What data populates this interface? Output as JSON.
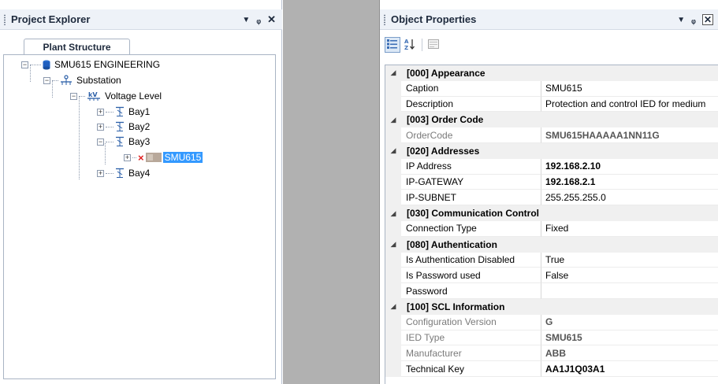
{
  "project_explorer": {
    "title": "Project Explorer",
    "tab": "Plant Structure",
    "tree": {
      "root": "SMU615 ENGINEERING",
      "substation": "Substation",
      "voltage_level": "Voltage Level",
      "bays": [
        "Bay1",
        "Bay2",
        "Bay3",
        "Bay4"
      ],
      "ied": "SMU615"
    }
  },
  "object_properties": {
    "title": "Object Properties",
    "categories": [
      {
        "label": "[000] Appearance",
        "props": [
          {
            "name": "Caption",
            "value": "SMU615"
          },
          {
            "name": "Description",
            "value": "Protection and control IED for medium"
          }
        ]
      },
      {
        "label": "[003] Order Code",
        "props": [
          {
            "name": "OrderCode",
            "value": "SMU615HAAAAA1NN11G"
          }
        ]
      },
      {
        "label": "[020] Addresses",
        "props": [
          {
            "name": "IP Address",
            "value": "192.168.2.10"
          },
          {
            "name": "IP-GATEWAY",
            "value": "192.168.2.1"
          },
          {
            "name": "IP-SUBNET",
            "value": "255.255.255.0"
          }
        ]
      },
      {
        "label": "[030] Communication Control",
        "props": [
          {
            "name": "Connection Type",
            "value": "Fixed"
          }
        ]
      },
      {
        "label": "[080] Authentication",
        "props": [
          {
            "name": "Is Authentication Disabled",
            "value": "True"
          },
          {
            "name": "Is Password used",
            "value": "False"
          },
          {
            "name": "Password",
            "value": ""
          }
        ]
      },
      {
        "label": "[100] SCL Information",
        "props": [
          {
            "name": "Configuration Version",
            "value": "G"
          },
          {
            "name": "IED Type",
            "value": "SMU615"
          },
          {
            "name": "Manufacturer",
            "value": "ABB"
          },
          {
            "name": "Technical Key",
            "value": "AA1J1Q03A1"
          }
        ]
      }
    ]
  },
  "icons": {
    "dropdown": "chevron-down-icon",
    "pin": "pin-icon",
    "close": "close-icon",
    "categorized": "categorized-icon",
    "alphabetical": "sort-az-icon",
    "property_pages": "property-pages-icon"
  },
  "colors": {
    "selection": "#3399ff",
    "header_bg": "#eef2f8",
    "middle_area": "#b1b1b1",
    "error_mark": "#e02020"
  }
}
